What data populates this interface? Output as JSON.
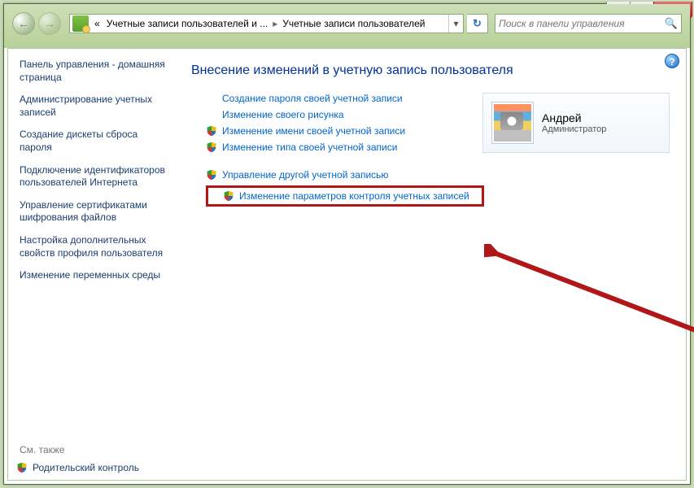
{
  "titlebar": {
    "min": "▁",
    "max": "▢",
    "close": "✕"
  },
  "nav": {
    "back": "←",
    "fwd": "→",
    "crumb1_prefix": "«",
    "crumb1": "Учетные записи пользователей и ...",
    "crumb2": "Учетные записи пользователей",
    "dropdown": "▾",
    "refresh": "↻"
  },
  "search": {
    "placeholder": "Поиск в панели управления",
    "icon": "🔍"
  },
  "sidebar": {
    "home": "Панель управления - домашняя страница",
    "links": [
      "Администрирование учетных записей",
      "Создание дискеты сброса пароля",
      "Подключение идентификаторов пользователей Интернета",
      "Управление сертификатами шифрования файлов",
      "Настройка дополнительных свойств профиля пользователя",
      "Изменение переменных среды"
    ],
    "see_also": "См. также",
    "parental": "Родительский контроль"
  },
  "main": {
    "heading": "Внесение изменений в учетную запись пользователя",
    "group1": [
      {
        "shield": false,
        "text": "Создание пароля своей учетной записи"
      },
      {
        "shield": false,
        "text": "Изменение своего рисунка"
      },
      {
        "shield": true,
        "text": "Изменение имени своей учетной записи"
      },
      {
        "shield": true,
        "text": "Изменение типа своей учетной записи"
      }
    ],
    "group2": [
      {
        "shield": true,
        "text": "Управление другой учетной записью"
      }
    ],
    "highlighted": {
      "shield": true,
      "text": "Изменение параметров контроля учетных записей"
    }
  },
  "user": {
    "name": "Андрей",
    "role": "Администратор"
  },
  "help": "?"
}
